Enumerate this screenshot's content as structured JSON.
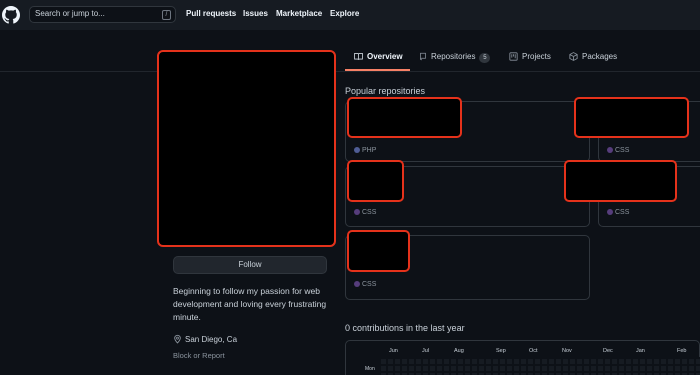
{
  "header": {
    "search": {
      "placeholder": "Search or jump to...",
      "shortcut": "/"
    },
    "nav": [
      "Pull requests",
      "Issues",
      "Marketplace",
      "Explore"
    ]
  },
  "profile": {
    "follow_label": "Follow",
    "bio": "Beginning to follow my passion for web development and loving every frustrating minute.",
    "location": "San Diego, Ca",
    "block_label": "Block or Report"
  },
  "tabs": [
    {
      "label": "Overview",
      "icon": "book-icon",
      "active": true
    },
    {
      "label": "Repositories",
      "icon": "repo-icon",
      "count": "5"
    },
    {
      "label": "Projects",
      "icon": "project-icon"
    },
    {
      "label": "Packages",
      "icon": "package-icon"
    }
  ],
  "popular_title": "Popular repositories",
  "repos": [
    {
      "language": "PHP"
    },
    {
      "language": "CSS"
    },
    {
      "language": "CSS"
    },
    {
      "language": "CSS"
    },
    {
      "language": "CSS"
    }
  ],
  "contributions": {
    "title": "0 contributions in the last year",
    "months": [
      "Jun",
      "Jul",
      "Aug",
      "Sep",
      "Oct",
      "Nov",
      "Dec",
      "Jan",
      "Feb"
    ],
    "day_label": "Mon"
  },
  "colors": {
    "accent": "#f78166",
    "redaction_border": "#e5321b",
    "css_dot": "#563d7c"
  }
}
